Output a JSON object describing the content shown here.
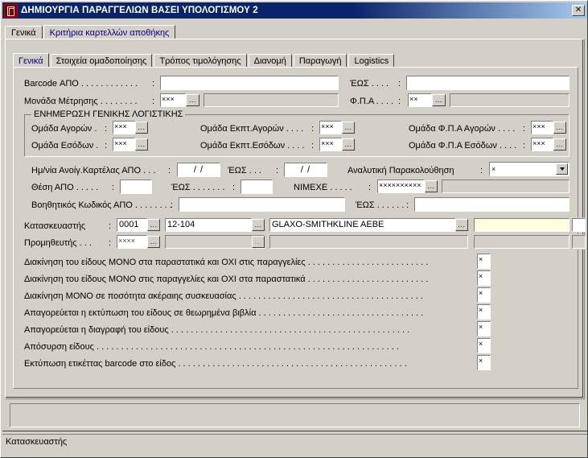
{
  "window": {
    "title": "ΔΗΜΙΟΥΡΓΙΑ ΠΑΡΑΓΓΕΛΙΩΝ ΒΑΣΕΙ ΥΠΟΛΟΓΙΣΜΟΥ 2",
    "close_label": "✕",
    "icon": "app-icon"
  },
  "outer_tabs": [
    {
      "label": "Γενικά",
      "selected": false
    },
    {
      "label": "Κριτήρια καρτελλών αποθήκης",
      "selected": true
    }
  ],
  "inner_tabs": [
    {
      "label": "Γενικά",
      "selected": true
    },
    {
      "label": "Στοιχεία ομαδοποίησης",
      "selected": false
    },
    {
      "label": "Τρόπος τιμολόγησης",
      "selected": false
    },
    {
      "label": "Διανομή",
      "selected": false
    },
    {
      "label": "Παραγωγή",
      "selected": false
    },
    {
      "label": "Logistics",
      "selected": false
    }
  ],
  "form": {
    "barcode_from_label": "Barcode ΑΠΟ . . . . . . . . . . . .",
    "barcode_from_colon": ":",
    "barcode_from_value": "",
    "barcode_to_label": "ΈΩΣ . . . .",
    "barcode_to_colon": ":",
    "barcode_to_value": "",
    "unit_label": "Μονάδα Μέτρησης . . . . . . . .",
    "unit_colon": ":",
    "unit_value": "×××",
    "unit_browse": "...",
    "unit_desc": "",
    "vat_label": "Φ.Π.Α . . . .",
    "vat_colon": ":",
    "vat_value": "××",
    "vat_browse": "...",
    "vat_desc": ""
  },
  "accounting_group": {
    "title": "ΕΝΗΜΕΡΩΣΗ ΓΕΝΙΚΗΣ ΛΟΓΙΣΤΙΚΗΣ",
    "rows": [
      {
        "label": "Ομάδα Αγορών .",
        "colon": ":",
        "value": "×××",
        "browse": "...",
        "label2": "Ομάδα Εκπτ.Αγορών . . . .",
        "colon2": ":",
        "value2": "×××",
        "browse2": "...",
        "label3": "Ομάδα Φ.Π.Α Αγορών . . . .",
        "colon3": ":",
        "value3": "×××",
        "browse3": "..."
      },
      {
        "label": "Ομάδα Εσόδων .",
        "colon": ":",
        "value": "×××",
        "browse": "...",
        "label2": "Ομάδα Εκπτ.Εσόδων . . . .",
        "colon2": ":",
        "value2": "×××",
        "browse2": "...",
        "label3": "Ομάδα Φ.Π.Α Εσόδων . . . .",
        "colon3": ":",
        "value3": "×××",
        "browse3": "..."
      }
    ]
  },
  "dates": {
    "open_from_label": "Ημ/νία Ανοίγ.Καρτέλας ΑΠΟ . . .",
    "open_from_colon": ":",
    "open_from_value": "/  /",
    "open_to_label": "ΈΩΣ . . .",
    "open_to_colon": ":",
    "open_to_value": "/  /",
    "analytic_label": "Αναλυτική Παρακολούθηση",
    "analytic_colon": ":",
    "analytic_value": "×"
  },
  "position": {
    "from_label": "Θέση  ΑΠΟ . . . . .",
    "from_colon": ":",
    "from_value": "",
    "to_label": "ΈΩΣ . . . . . . .",
    "to_colon": ":",
    "to_value": "",
    "nimexe_label": "NIMEXE . . . . .",
    "nimexe_colon": ":",
    "nimexe_value": "××××××××××",
    "nimexe_browse": "...",
    "nimexe_desc": ""
  },
  "aux_code": {
    "from_label": "Βοηθητικός Κωδικός ΑΠΟ . . . . . . . .",
    "from_colon": ":",
    "from_value": "",
    "to_label": "ΈΩΣ . . . . . .",
    "to_colon": ":",
    "to_value": ""
  },
  "manufacturer": {
    "label": "Κατασκευαστής",
    "colon": ":",
    "code": "0001",
    "code_browse": "...",
    "code2": "12-104",
    "code2_browse": "...",
    "name": "GLAXO-SMITHKLINE AEBE",
    "name_browse": "...",
    "extra": "",
    "flag": ""
  },
  "supplier": {
    "label": "Προμηθευτής . . .",
    "colon": ":",
    "code": "××××",
    "code_browse": "...",
    "code2": "",
    "code2_browse": "...",
    "name": "",
    "extra": "",
    "flag": ""
  },
  "flags": [
    {
      "label": "Διακίνηση του είδους ΜΟΝΟ στα παραστατικά και ΟΧΙ στις παραγγελίες . . . . . . . . . . . . . . . . . . . . . . . . .",
      "value": "×"
    },
    {
      "label": "Διακίνηση του είδους ΜΟΝΟ στις παραγγελίες και ΟΧΙ στα παραστατικά . . . . . . . . . . . . . . . . . . . . . . . . .",
      "value": "×"
    },
    {
      "label": "Διακίνηση ΜΟΝΟ σε ποσότητα ακέραιης συσκευασίας . . . . . . . . . . . . . . . . . . . . . . . . . . . . . . . . . . . . . .",
      "value": "×"
    },
    {
      "label": "Απαγορεύεται η εκτύπωση του είδους σε θεωρημένα βιβλία . . . . . . . . . . . . . . . . . . . . . . . . . . . . . . . . . .",
      "value": "×"
    },
    {
      "label": "Απαγορεύεται η διαγραφή του είδους . . . . . . . . . . . . . . . . . . . . . . . . . . . . . . . . . . . . . . . . . . . . . . . . .",
      "value": "×"
    },
    {
      "label": "Απόσυρση είδους . . . . . . . . . . . . . . . . . . . . . . . . . . . . . . . . . . . . . . . . . . . . . . . . . . . . . . . . . . . . . .",
      "value": "×"
    },
    {
      "label": "Εκτύπωση ετικέττας barcode στο είδος . . . . . . . . . . . . . . . . . . . . . . . . . . . . . . . . . . . . . . . . . . . . . . .",
      "value": "×"
    }
  ],
  "statusbar": {
    "text": "Κατασκευαστής"
  }
}
